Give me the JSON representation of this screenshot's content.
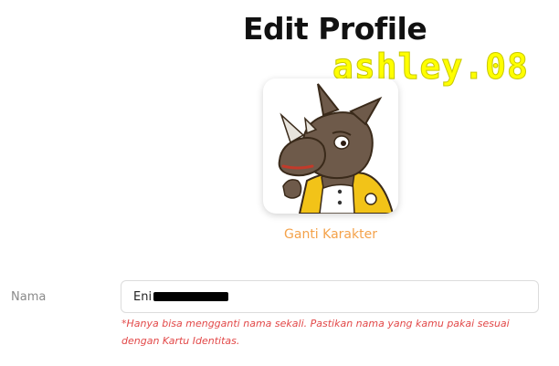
{
  "header": {
    "title": "Edit Profile"
  },
  "watermark": {
    "text": "ashley.08",
    "color": "#ffff00"
  },
  "avatar": {
    "icon": "rhino-character-avatar",
    "change_label": "Ganti Karakter",
    "accent_color": "#f4a24a"
  },
  "form": {
    "name_label": "Nama",
    "name_value": "Eni",
    "name_redacted": true,
    "hint": "*Hanya bisa mengganti nama sekali. Pastikan nama yang kamu pakai sesuai dengan Kartu Identitas.",
    "hint_color": "#e24848"
  }
}
